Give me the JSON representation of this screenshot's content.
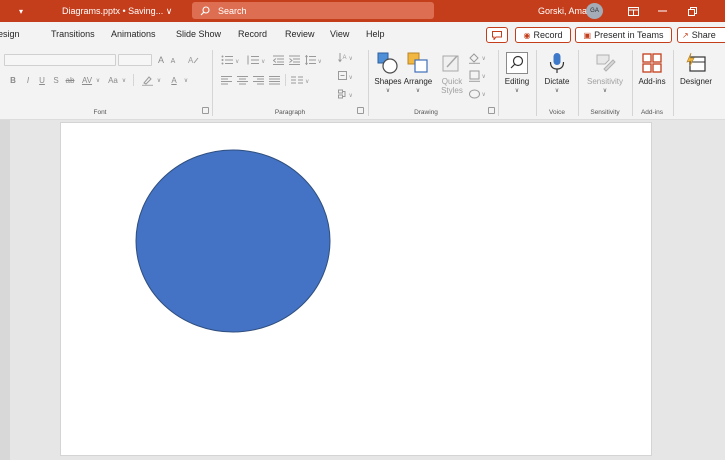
{
  "titlebar": {
    "doc_title": "Diagrams.pptx • Saving... ∨",
    "search_placeholder": "Search",
    "user_name": "Gorski, Amanda",
    "user_initials": "GA"
  },
  "ribbon_tabs": [
    "esign",
    "Transitions",
    "Animations",
    "Slide Show",
    "Record",
    "Review",
    "View",
    "Help"
  ],
  "actions": {
    "record": "Record",
    "present_in_teams": "Present in Teams",
    "share": "Share"
  },
  "font_group": {
    "label": "Font",
    "bold": "B",
    "italic": "I",
    "underline": "U",
    "shadow": "S",
    "strikethrough": "ab",
    "spacing": "AV",
    "case": "Aa",
    "color": "A",
    "grow": "A",
    "shrink": "A"
  },
  "paragraph_group": {
    "label": "Paragraph"
  },
  "drawing_group": {
    "label": "Drawing",
    "shapes": "Shapes",
    "arrange": "Arrange",
    "quick_styles_1": "Quick",
    "quick_styles_2": "Styles"
  },
  "editing": {
    "label": "Editing"
  },
  "voice_group": {
    "label": "Voice",
    "dictate": "Dictate"
  },
  "sensitivity_group": {
    "label": "Sensitivity",
    "button": "Sensitivity"
  },
  "addins_group": {
    "label": "Add-ins",
    "button": "Add-ins"
  },
  "designer": {
    "label": "Designer"
  },
  "colors": {
    "accent": "#c43e1c",
    "circle_fill": "#4472c4",
    "circle_stroke": "#2f4f7f"
  }
}
